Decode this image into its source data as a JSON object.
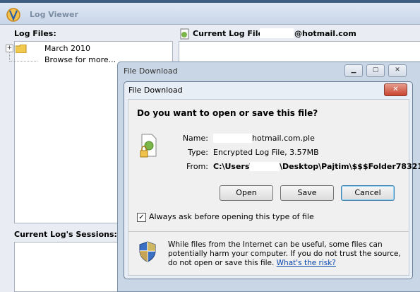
{
  "app": {
    "title": "Log Viewer"
  },
  "left": {
    "log_files_label": "Log Files:",
    "tree": [
      {
        "label": "March 2010"
      },
      {
        "label": "Browse for more..."
      }
    ],
    "sessions_label": "Current Log's Sessions:"
  },
  "current": {
    "label": "Current Log File:",
    "email": "@hotmail.com"
  },
  "outer_window": {
    "title": "File Download"
  },
  "dialog": {
    "title": "File Download",
    "question": "Do you want to open or save this file?",
    "name_label": "Name:",
    "name_value": "hotmail.com.ple",
    "type_label": "Type:",
    "type_value": "Encrypted Log File, 3.57MB",
    "from_label": "From:",
    "from_prefix": "C:\\Users\\",
    "from_suffix": "\\Desktop\\Pajtim\\$$$Folder78321",
    "buttons": {
      "open": "Open",
      "save": "Save",
      "cancel": "Cancel"
    },
    "always_ask": "Always ask before opening this type of file",
    "always_ask_checked": true,
    "warning": "While files from the Internet can be useful, some files can potentially harm your computer. If you do not trust the source, do not open or save this file.",
    "risk_link": "What's the risk?"
  }
}
